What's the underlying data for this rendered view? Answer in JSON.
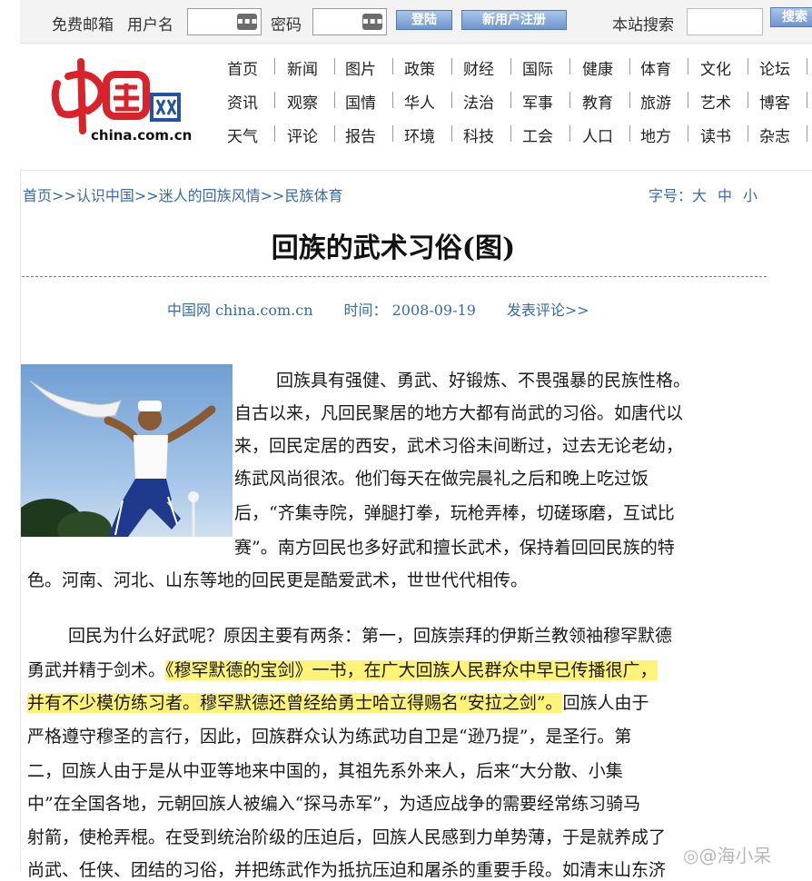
{
  "topbar": {
    "mail_label": "免费邮箱",
    "user_label": "用户名",
    "pwd_label": "密码",
    "login_btn": "登陆",
    "register_btn": "新用户注册",
    "search_label": "本站搜索",
    "search_btn": "搜索"
  },
  "logo": {
    "url_text": "china.com.cn"
  },
  "nav": {
    "rows": [
      [
        "首页",
        "新闻",
        "图片",
        "政策",
        "财经",
        "国际",
        "健康",
        "体育",
        "文化",
        "论坛"
      ],
      [
        "资讯",
        "观察",
        "国情",
        "华人",
        "法治",
        "军事",
        "教育",
        "旅游",
        "艺术",
        "博客"
      ],
      [
        "天气",
        "评论",
        "报告",
        "环境",
        "科技",
        "工会",
        "人口",
        "地方",
        "读书",
        "杂志"
      ]
    ]
  },
  "breadcrumb": "首页>>认识中国>>迷人的回族风情>>民族体育",
  "fontsize": {
    "label": "字号：",
    "large": "大",
    "medium": "中",
    "small": "小"
  },
  "article": {
    "title": "回族的武术习俗(图)",
    "source": "中国网 china.com.cn",
    "time": "时间： 2008-09-19",
    "comment": "发表评论>>",
    "p1_lines": [
      "回族具有强健、勇武、好锻炼、不畏强暴的民族性格。",
      "自古以来，凡回民聚居的地方大都有尚武的习俗。如唐代以",
      "来，回民定居的西安，武术习俗未间断过，过去无论老幼，",
      "练武风尚很浓。他们每天在做完晨礼之后和晚上吃过饭",
      "后，“齐集寺院，弹腿打拳，玩枪弄棒，切磋琢磨，互试比",
      "赛”。南方回民也多好武和擅长武术，保持着回回民族的特",
      "色。河南、河北、山东等地的回民更是酷爱武术，世世代代相传。"
    ],
    "p2_line1": "回民为什么好武呢？原因主要有两条：第一，回族崇拜的伊斯兰教领袖穆罕默德",
    "p2_line2a": "勇武并精于剑术。",
    "p2_line2b": "《穆罕默德的宝剑》一书，在广大回族人民群众中早已传播很广，",
    "p2_line3a": "并有不少模仿练习者。穆罕默德还曾经给勇士哈立得赐名“安拉之剑”。",
    "p2_line3b": "回族人由于",
    "p2_line4": "严格遵守穆圣的言行，因此，回族群众认为练武功自卫是“逊乃提”，是圣行。第",
    "p2_line5": "二，回族人由于是从中亚等地来中国的，其祖先系外来人，后来“大分散、小集",
    "p2_line6": "中”在全国各地，元朝回族人被编入“探马赤军”，为适应战争的需要经常练习骑马",
    "p2_line7": "射箭，使枪弄棍。在受到统治阶级的压迫后，回族人民感到力单势薄，于是就养成了",
    "p2_line8": "尚武、任侠、团结的习俗，并把练武作为抵抗压迫和屠杀的重要手段。如清末山东济"
  },
  "watermark": "@海小呆",
  "colors": {
    "link": "#3a6aa5",
    "highlight": "#fff37a",
    "logo_red": "#d8232a",
    "logo_blue": "#2552a4"
  }
}
